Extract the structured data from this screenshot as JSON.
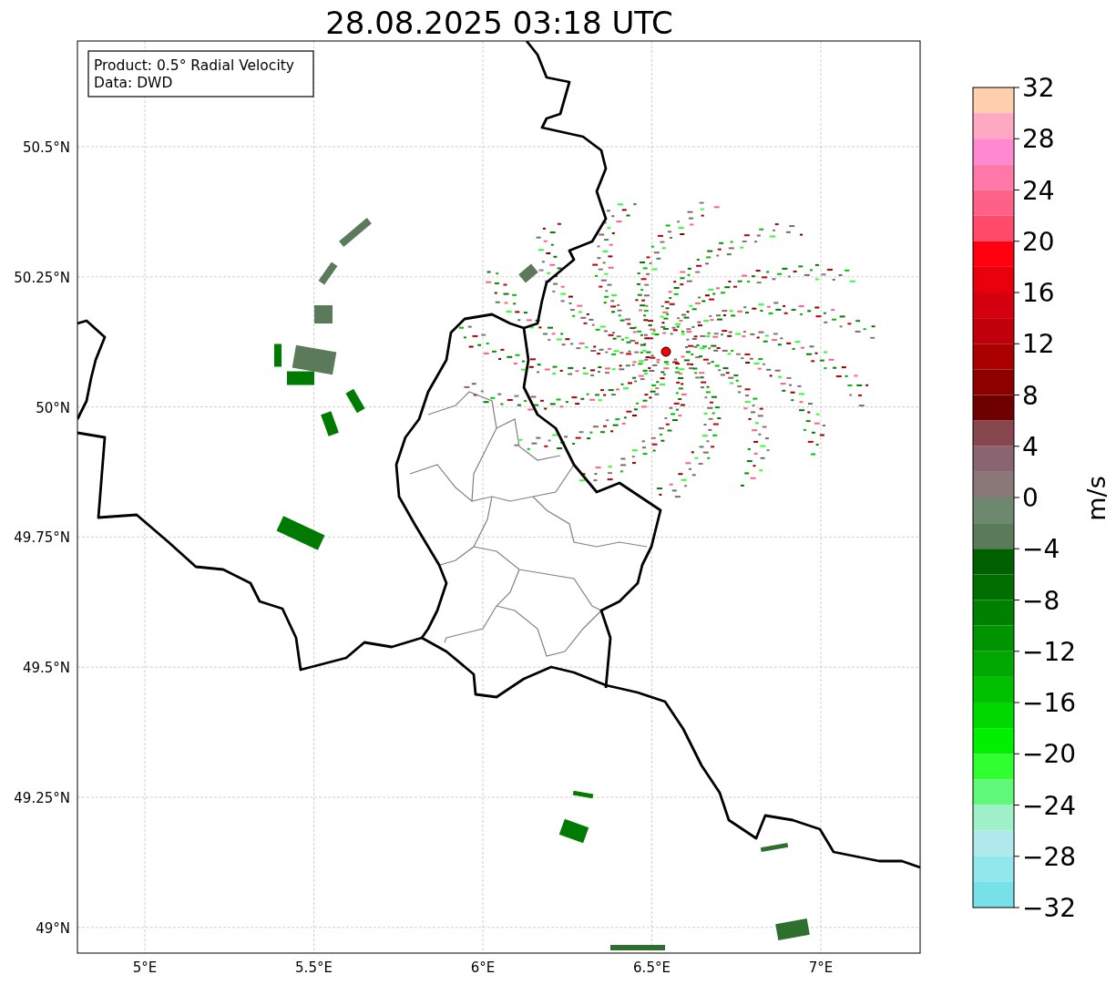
{
  "title": "28.08.2025 03:18 UTC",
  "legend": [
    "Product: 0.5° Radial Velocity",
    "Data: DWD"
  ],
  "map": {
    "lat_ticks": [
      "50.5°N",
      "50.25°N",
      "50°N",
      "49.75°N",
      "49.5°N",
      "49.25°N",
      "49°N"
    ],
    "lon_ticks": [
      "5°E",
      "5.5°E",
      "6°E",
      "6.5°E",
      "7°E"
    ]
  },
  "colorbar": {
    "label": "m/s",
    "ticks": [
      "32",
      "28",
      "24",
      "20",
      "16",
      "12",
      "8",
      "4",
      "0",
      "−4",
      "−8",
      "−12",
      "−16",
      "−20",
      "−24",
      "−28",
      "−32"
    ],
    "bands": [
      {
        "color": "#ffcfae"
      },
      {
        "color": "#ffa8c4"
      },
      {
        "color": "#ff88d0"
      },
      {
        "color": "#ff78a8"
      },
      {
        "color": "#ff6088"
      },
      {
        "color": "#ff4a6a"
      },
      {
        "color": "#ff0010"
      },
      {
        "color": "#e8000c"
      },
      {
        "color": "#d40010"
      },
      {
        "color": "#c0000a"
      },
      {
        "color": "#aa0000"
      },
      {
        "color": "#8c0000"
      },
      {
        "color": "#6e0000"
      },
      {
        "color": "#88464e"
      },
      {
        "color": "#8a6470"
      },
      {
        "color": "#8a7878"
      },
      {
        "color": "#6e8870"
      },
      {
        "color": "#5a7a5a"
      },
      {
        "color": "#006000"
      },
      {
        "color": "#006e00"
      },
      {
        "color": "#008000"
      },
      {
        "color": "#009400"
      },
      {
        "color": "#00a800"
      },
      {
        "color": "#00c000"
      },
      {
        "color": "#00d800"
      },
      {
        "color": "#00f000"
      },
      {
        "color": "#30ff30"
      },
      {
        "color": "#60f878"
      },
      {
        "color": "#9ef0c8"
      },
      {
        "color": "#b0e8ee"
      },
      {
        "color": "#90e8ec"
      },
      {
        "color": "#78e0e8"
      }
    ]
  }
}
